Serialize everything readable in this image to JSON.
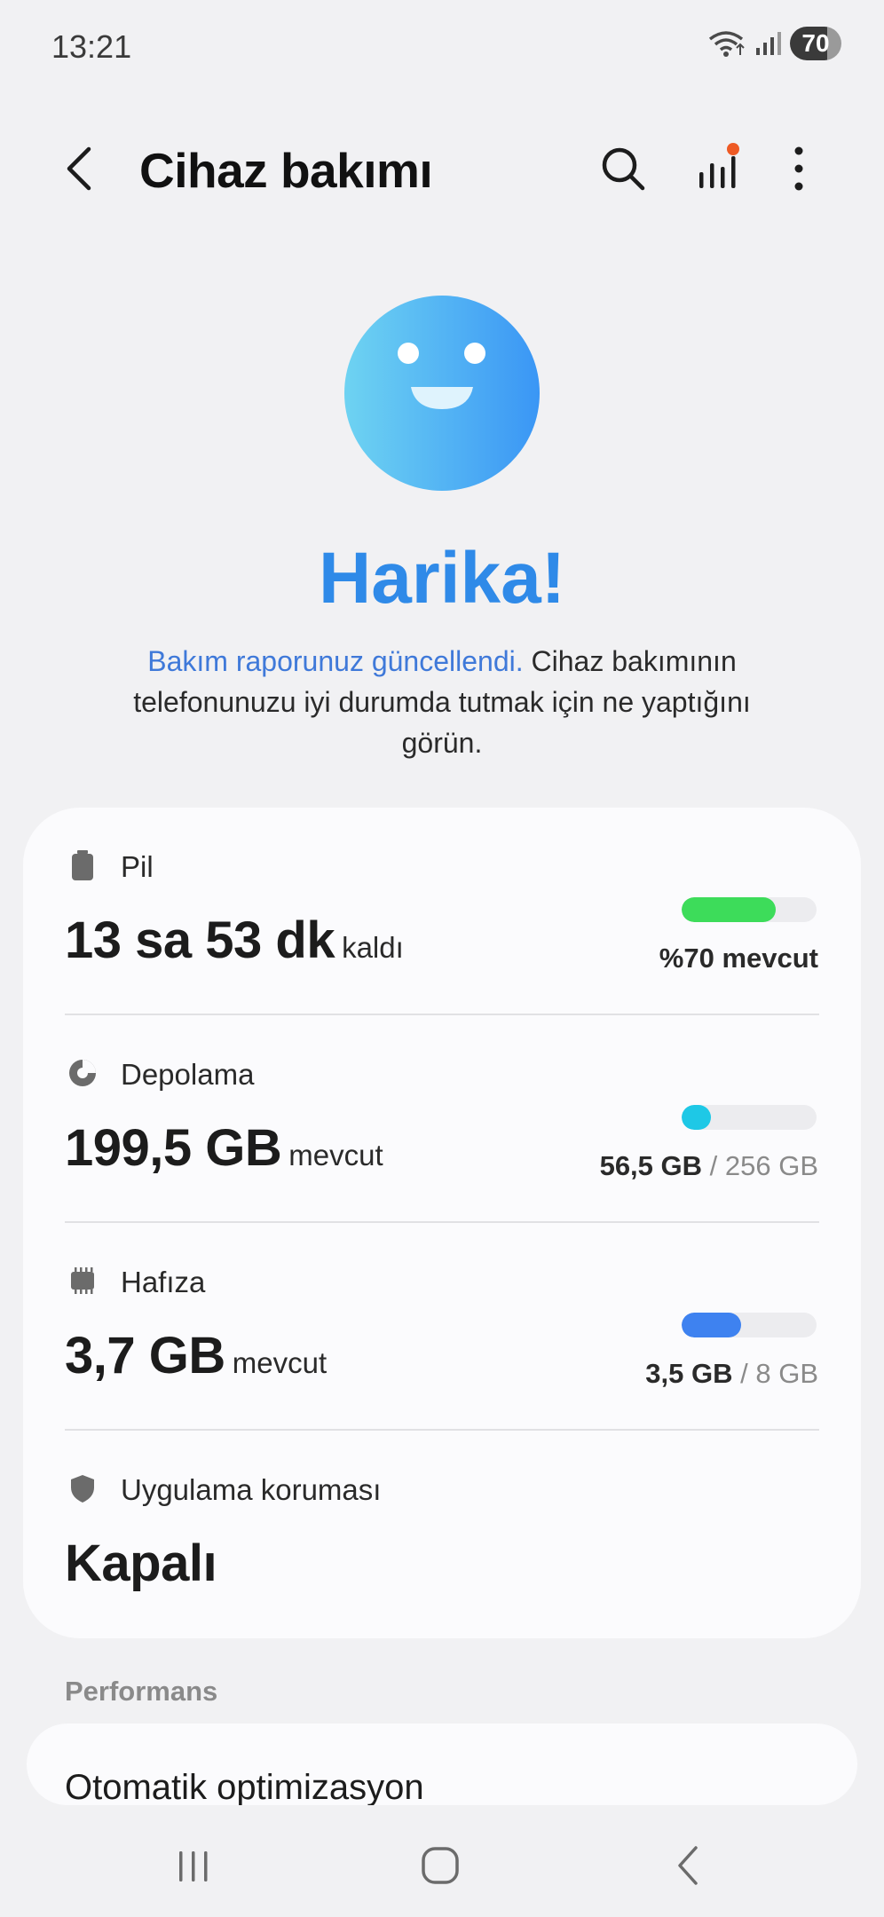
{
  "status_bar": {
    "time": "13:21",
    "battery": "70"
  },
  "header": {
    "title": "Cihaz bakımı"
  },
  "hero": {
    "title": "Harika!",
    "link_text": "Bakım raporunuz güncellendi.",
    "description": " Cihaz bakımının telefonunuzu iyi durumda tutmak için ne yaptığını görün."
  },
  "sections": {
    "battery": {
      "label": "Pil",
      "value": "13 sa 53 dk",
      "suffix": "kaldı",
      "right": "%70 mevcut",
      "level": 0.7,
      "color": "#3ddc5a"
    },
    "storage": {
      "label": "Depolama",
      "value": "199,5 GB",
      "suffix": "mevcut",
      "used": "56,5 GB",
      "total": " / 256 GB",
      "level": 0.22,
      "color": "#1ec8e6"
    },
    "memory": {
      "label": "Hafıza",
      "value": "3,7 GB",
      "suffix": "mevcut",
      "used": "3,5 GB",
      "total": " / 8 GB",
      "level": 0.44,
      "color": "#3e82f0"
    },
    "app_protection": {
      "label": "Uygulama koruması",
      "value": "Kapalı"
    }
  },
  "performance": {
    "heading": "Performans",
    "item": "Otomatik optimizasyon"
  },
  "icons": {
    "back": "chevron-left-icon",
    "search": "search-icon",
    "stats": "bar-chart-icon",
    "more": "more-vertical-icon",
    "battery": "battery-icon",
    "storage": "pie-chart-icon",
    "memory": "memory-chip-icon",
    "shield": "shield-icon",
    "recents": "recents-icon",
    "home": "home-icon",
    "nav_back": "back-icon"
  }
}
